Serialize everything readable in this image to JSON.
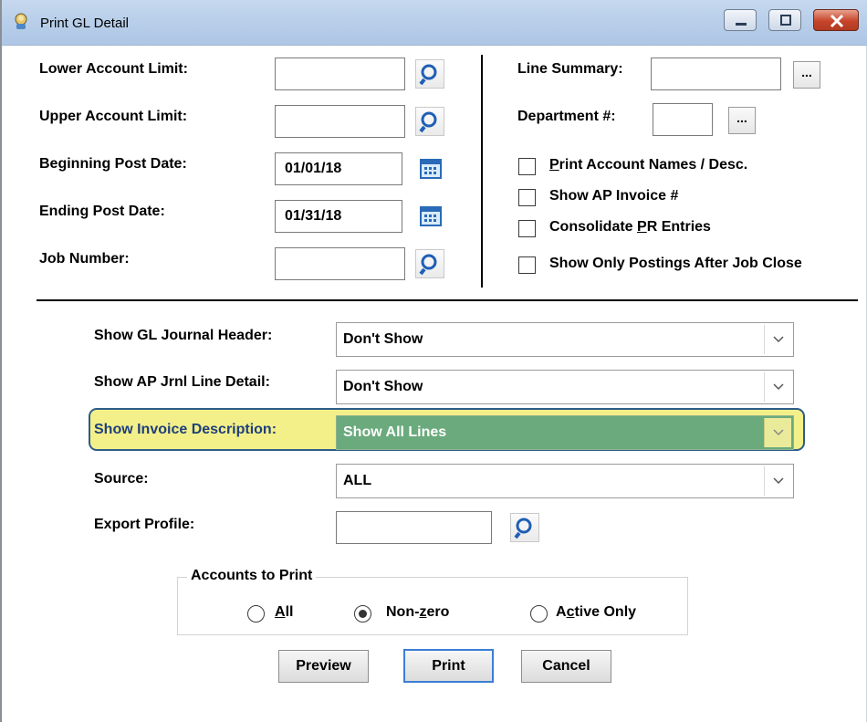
{
  "window": {
    "title": "Print GL Detail"
  },
  "left_fields": {
    "lower_account_limit": {
      "label": "Lower Account Limit:",
      "value": ""
    },
    "upper_account_limit": {
      "label": "Upper Account Limit:",
      "value": ""
    },
    "beginning_post_date": {
      "label": "Beginning Post Date:",
      "value": "01/01/18"
    },
    "ending_post_date": {
      "label": "Ending Post Date:",
      "value": "01/31/18"
    },
    "job_number": {
      "label": "Job Number:",
      "value": ""
    }
  },
  "right_fields": {
    "line_summary": {
      "label": "Line Summary:",
      "value": ""
    },
    "department": {
      "label": "Department #:",
      "value": ""
    },
    "ellipsis_label": "..."
  },
  "options": {
    "print_account_names": {
      "pre": "",
      "u": "P",
      "post": "rint Account Names / Desc.",
      "checked": false
    },
    "show_ap_invoice": {
      "label": "Show AP Invoice #",
      "checked": false
    },
    "consolidate_pr": {
      "pre": "Consolidate ",
      "u": "P",
      "post": "R Entries",
      "checked": false
    },
    "show_only_after_close": {
      "label": "Show Only Postings After Job Close",
      "checked": false
    }
  },
  "combos": {
    "gl_journal_header": {
      "label": "Show GL Journal Header:",
      "value": "Don't Show"
    },
    "ap_jrnl_line_detail": {
      "label": "Show AP Jrnl Line Detail:",
      "value": "Don't Show"
    },
    "invoice_description": {
      "label": "Show Invoice Description:",
      "value": "Show All Lines",
      "highlight": "#6aaa7c"
    },
    "source": {
      "label": "Source:",
      "value": "ALL"
    }
  },
  "export_profile": {
    "label": "Export Profile:",
    "value": ""
  },
  "accounts_to_print": {
    "title": "Accounts to Print",
    "all": {
      "pre": "",
      "u": "A",
      "post": "ll"
    },
    "non_zero": {
      "pre": "Non-",
      "u": "z",
      "post": "ero"
    },
    "active_only": {
      "pre": "A",
      "u": "c",
      "post": "tive Only"
    },
    "selected": "non_zero"
  },
  "buttons": {
    "preview": "Preview",
    "print": "Print",
    "cancel": "Cancel"
  },
  "colors": {
    "highlight_border": "#2d5c87",
    "highlight_fill": "#f3f08a",
    "selected_combo": "#6aaa7c"
  }
}
